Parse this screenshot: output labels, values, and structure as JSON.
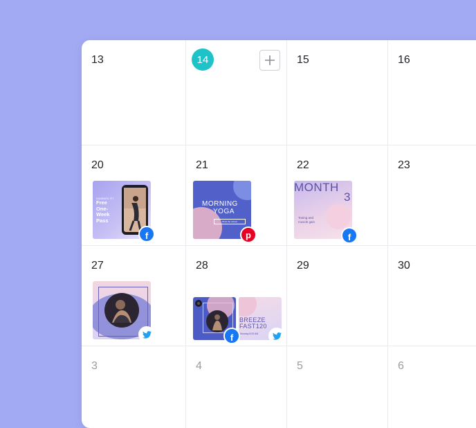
{
  "calendar": {
    "today": "14",
    "weeks": [
      {
        "days": [
          "13",
          "14",
          "15",
          "16"
        ]
      },
      {
        "days": [
          "20",
          "21",
          "22",
          "23"
        ]
      },
      {
        "days": [
          "27",
          "28",
          "29",
          "30"
        ]
      },
      {
        "days": [
          "3",
          "4",
          "5",
          "6"
        ]
      }
    ]
  },
  "posts": {
    "p20": {
      "network": "facebook",
      "tag": "SANDBOX FIT",
      "text": "Free One-Week Pass"
    },
    "p21": {
      "network": "pinterest",
      "title_line1": "MORNING",
      "title_line2": "YOGA",
      "cta": "Book the retreat"
    },
    "p22": {
      "network": "facebook",
      "title": "MONTH",
      "number": "3",
      "caption": "Toning and muscle gain"
    },
    "p27": {
      "network": "twitter"
    },
    "p28a": {
      "network": "facebook"
    },
    "p28b": {
      "network": "twitter",
      "title_line1": "BREEZE",
      "title_line2": "FAST120",
      "footer": "Monday 8:00 AM"
    }
  },
  "colors": {
    "background": "#a2aaf3",
    "accent": "#1dc3c8",
    "facebook": "#1877f2",
    "twitter": "#1da1f2",
    "pinterest": "#e60023"
  }
}
